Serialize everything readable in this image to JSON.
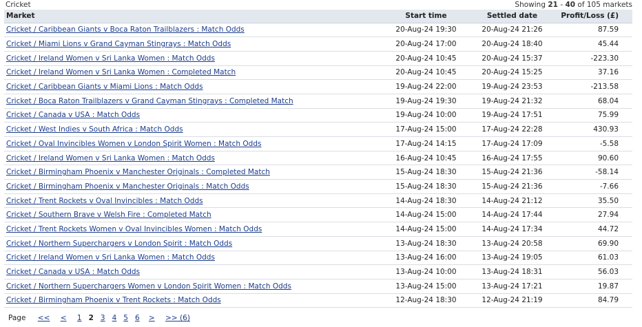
{
  "header": {
    "sport": "Cricket",
    "showing_prefix": "Showing",
    "range_start": "21",
    "range_sep": "-",
    "range_end": "40",
    "showing_suffix": "of 105 markets"
  },
  "table": {
    "columns": {
      "market": "Market",
      "start": "Start time",
      "settled": "Settled date",
      "pl": "Profit/Loss (£)"
    },
    "rows": [
      {
        "market": "Cricket / Caribbean Giants v Boca Raton Trailblazers : Match Odds",
        "start": "20-Aug-24 19:30",
        "settled": "20-Aug-24 21:26",
        "pl": "87.59"
      },
      {
        "market": "Cricket / Miami Lions v Grand Cayman Stingrays : Match Odds",
        "start": "20-Aug-24 17:00",
        "settled": "20-Aug-24 18:40",
        "pl": "45.44"
      },
      {
        "market": "Cricket / Ireland Women v Sri Lanka Women : Match Odds",
        "start": "20-Aug-24 10:45",
        "settled": "20-Aug-24 15:37",
        "pl": "-223.30"
      },
      {
        "market": "Cricket / Ireland Women v Sri Lanka Women : Completed Match",
        "start": "20-Aug-24 10:45",
        "settled": "20-Aug-24 15:25",
        "pl": "37.16"
      },
      {
        "market": "Cricket / Caribbean Giants v Miami Lions : Match Odds",
        "start": "19-Aug-24 22:00",
        "settled": "19-Aug-24 23:53",
        "pl": "-213.58"
      },
      {
        "market": "Cricket / Boca Raton Trailblazers v Grand Cayman Stingrays : Completed Match",
        "start": "19-Aug-24 19:30",
        "settled": "19-Aug-24 21:32",
        "pl": "68.04"
      },
      {
        "market": "Cricket / Canada v USA : Match Odds",
        "start": "19-Aug-24 10:00",
        "settled": "19-Aug-24 17:51",
        "pl": "75.99"
      },
      {
        "market": "Cricket / West Indies v South Africa : Match Odds",
        "start": "17-Aug-24 15:00",
        "settled": "17-Aug-24 22:28",
        "pl": "430.93"
      },
      {
        "market": "Cricket / Oval Invincibles Women v London Spirit Women : Match Odds",
        "start": "17-Aug-24 14:15",
        "settled": "17-Aug-24 17:09",
        "pl": "-5.58"
      },
      {
        "market": "Cricket / Ireland Women v Sri Lanka Women : Match Odds",
        "start": "16-Aug-24 10:45",
        "settled": "16-Aug-24 17:55",
        "pl": "90.60"
      },
      {
        "market": "Cricket / Birmingham Phoenix v Manchester Originals : Completed Match",
        "start": "15-Aug-24 18:30",
        "settled": "15-Aug-24 21:36",
        "pl": "-58.14"
      },
      {
        "market": "Cricket / Birmingham Phoenix v Manchester Originals : Match Odds",
        "start": "15-Aug-24 18:30",
        "settled": "15-Aug-24 21:36",
        "pl": "-7.66"
      },
      {
        "market": "Cricket / Trent Rockets v Oval Invincibles : Match Odds",
        "start": "14-Aug-24 18:30",
        "settled": "14-Aug-24 21:12",
        "pl": "35.50"
      },
      {
        "market": "Cricket / Southern Brave v Welsh Fire : Completed Match",
        "start": "14-Aug-24 15:00",
        "settled": "14-Aug-24 17:44",
        "pl": "27.94"
      },
      {
        "market": "Cricket / Trent Rockets Women v Oval Invincibles Women : Match Odds",
        "start": "14-Aug-24 15:00",
        "settled": "14-Aug-24 17:34",
        "pl": "44.72"
      },
      {
        "market": "Cricket / Northern Superchargers v London Spirit : Match Odds",
        "start": "13-Aug-24 18:30",
        "settled": "13-Aug-24 20:58",
        "pl": "69.90"
      },
      {
        "market": "Cricket / Ireland Women v Sri Lanka Women : Match Odds",
        "start": "13-Aug-24 16:00",
        "settled": "13-Aug-24 19:05",
        "pl": "61.03"
      },
      {
        "market": "Cricket / Canada v USA : Match Odds",
        "start": "13-Aug-24 10:00",
        "settled": "13-Aug-24 18:31",
        "pl": "56.03"
      },
      {
        "market": "Cricket / Northern Superchargers Women v London Spirit Women : Match Odds",
        "start": "13-Aug-24 15:00",
        "settled": "13-Aug-24 17:21",
        "pl": "19.87"
      },
      {
        "market": "Cricket / Birmingham Phoenix v Trent Rockets : Match Odds",
        "start": "12-Aug-24 18:30",
        "settled": "12-Aug-24 21:19",
        "pl": "84.79"
      }
    ]
  },
  "pager": {
    "label": "Page",
    "first": "<<",
    "prev": "<",
    "pages": [
      "1",
      "2",
      "3",
      "4",
      "5",
      "6"
    ],
    "current": "2",
    "next": ">",
    "last": ">> (6)"
  },
  "colors": {
    "link": "#1a3c8c",
    "header_bg": "#e2e8ee"
  }
}
